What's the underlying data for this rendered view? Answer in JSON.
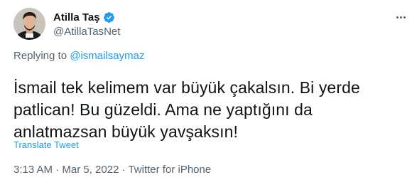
{
  "author": {
    "display_name": "Atilla Taş",
    "handle": "@AtillaTasNet",
    "verified": true,
    "avatar_icon": "profile-photo"
  },
  "reply": {
    "prefix": "Replying to ",
    "mention": "@ismailsaymaz"
  },
  "tweet": {
    "text": "İsmail tek kelimem var büyük çakalsın. Bi yerde patlican! Bu güzeldi. Ama ne yaptığını da anlatmazsan büyük yavşaksın!",
    "translate_label": "Translate Tweet",
    "timestamp": "3:13 AM · Mar 5, 2022 · Twitter for iPhone"
  },
  "colors": {
    "accent": "#1d9bf0",
    "secondary_text": "#536471",
    "primary_text": "#0f1419"
  }
}
